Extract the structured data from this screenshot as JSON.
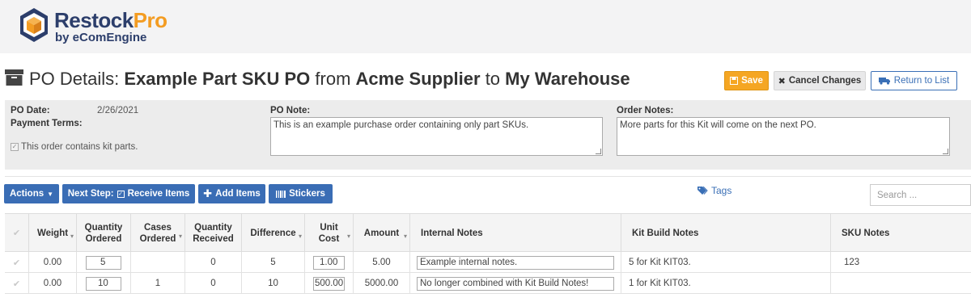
{
  "brand": {
    "name_main": "Restock",
    "name_accent": "Pro",
    "subtitle": "by eComEngine"
  },
  "title": {
    "prefix": "PO Details:",
    "po_name": "Example Part SKU PO",
    "from_word": "from",
    "supplier": "Acme Supplier",
    "to_word": "to",
    "warehouse": "My Warehouse"
  },
  "header_buttons": {
    "save": "Save",
    "cancel": "Cancel Changes",
    "return": "Return to List"
  },
  "details": {
    "po_date_label": "PO Date:",
    "po_date_value": "2/26/2021",
    "payment_terms_label": "Payment Terms:",
    "kit_parts_label": "This order contains kit parts.",
    "po_note_label": "PO Note:",
    "po_note_value": "This is an example purchase order containing only part SKUs.",
    "order_notes_label": "Order Notes:",
    "order_notes_value": "More parts for this Kit will come on the next PO."
  },
  "toolbar": {
    "actions": "Actions",
    "next_step": "Next Step:",
    "receive_items": "Receive Items",
    "add_items": "Add Items",
    "stickers": "Stickers",
    "tags": "Tags",
    "search_placeholder": "Search ..."
  },
  "columns": {
    "weight": "Weight",
    "qty_ordered_1": "Quantity",
    "qty_ordered_2": "Ordered",
    "cases_1": "Cases",
    "cases_2": "Ordered",
    "qty_received_1": "Quantity",
    "qty_received_2": "Received",
    "difference": "Difference",
    "unit_cost_1": "Unit",
    "unit_cost_2": "Cost",
    "amount": "Amount",
    "internal_notes": "Internal Notes",
    "kit_build_notes": "Kit Build Notes",
    "sku_notes": "SKU Notes"
  },
  "rows": [
    {
      "weight": "0.00",
      "qty_ordered": "5",
      "cases": "",
      "qty_received": "0",
      "difference": "5",
      "unit_cost": "1.00",
      "amount": "5.00",
      "internal_notes": "Example internal notes.",
      "kit_build_notes": "5 for Kit KIT03.",
      "sku_notes": "123"
    },
    {
      "weight": "0.00",
      "qty_ordered": "10",
      "cases": "1",
      "qty_received": "0",
      "difference": "10",
      "unit_cost": "500.00",
      "amount": "5000.00",
      "internal_notes": "No longer combined with Kit Build Notes!",
      "kit_build_notes": "1 for Kit KIT03.",
      "sku_notes": ""
    }
  ],
  "colors": {
    "primary": "#3a6db5",
    "save": "#f5a623",
    "brand_navy": "#2c3e6b",
    "brand_orange": "#f39c22"
  }
}
